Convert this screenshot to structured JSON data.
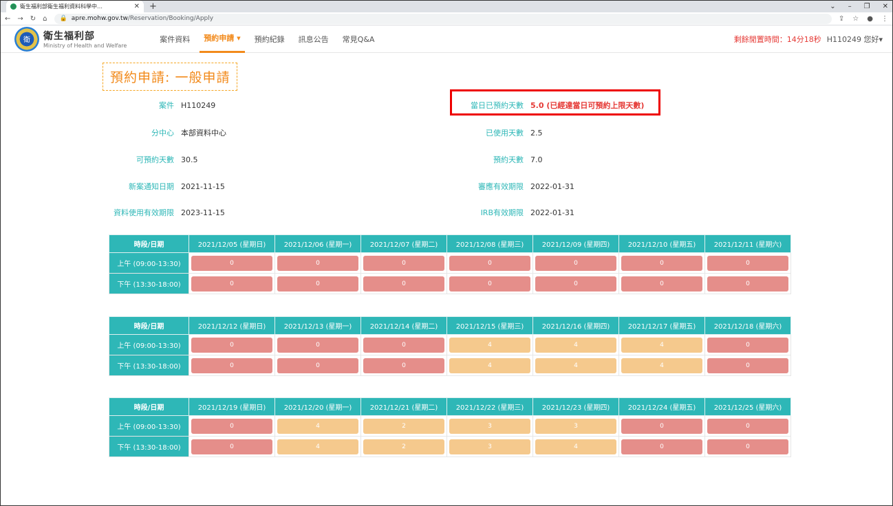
{
  "browser": {
    "tab_title": "衛生福利部衛生福利資料科學中…",
    "url_host": "apre.mohw.gov.tw",
    "url_path": "/Reservation/Booking/Apply"
  },
  "nav": {
    "brand_zh": "衛生福利部",
    "brand_en": "Ministry of Health and Welfare",
    "links": [
      "案件資料",
      "預約申請 ▾",
      "預約紀錄",
      "訊息公告",
      "常見Q&A"
    ],
    "timer": "剩餘閒置時間：14分18秒",
    "user": "H110249 您好▾"
  },
  "page": {
    "title": "預約申請: 一般申請"
  },
  "info": {
    "case_label": "案件",
    "case_value": "H110249",
    "center_label": "分中心",
    "center_value": "本部資料中心",
    "avail_label": "可預約天數",
    "avail_value": "30.5",
    "notify_label": "新案通知日期",
    "notify_value": "2021-11-15",
    "datause_label": "資料使用有效期限",
    "datause_value": "2023-11-15",
    "today_label": "當日已預約天數",
    "today_value": "5.0 (已經達當日可預約上限天數)",
    "used_label": "已使用天數",
    "used_value": "2.5",
    "reserved_label": "預約天數",
    "reserved_value": "7.0",
    "review_label": "審應有效期限",
    "review_value": "2022-01-31",
    "irb_label": "IRB有效期限",
    "irb_value": "2022-01-31"
  },
  "schedule": {
    "header_label": "時段/日期",
    "am_label": "上午 (09:00-13:30)",
    "pm_label": "下午 (13:30-18:00)",
    "weeks": [
      {
        "days": [
          "2021/12/05 (星期日)",
          "2021/12/06 (星期一)",
          "2021/12/07 (星期二)",
          "2021/12/08 (星期三)",
          "2021/12/09 (星期四)",
          "2021/12/10 (星期五)",
          "2021/12/11 (星期六)"
        ],
        "am": [
          "0",
          "0",
          "0",
          "0",
          "0",
          "0",
          "0"
        ],
        "pm": [
          "0",
          "0",
          "0",
          "0",
          "0",
          "0",
          "0"
        ]
      },
      {
        "days": [
          "2021/12/12 (星期日)",
          "2021/12/13 (星期一)",
          "2021/12/14 (星期二)",
          "2021/12/15 (星期三)",
          "2021/12/16 (星期四)",
          "2021/12/17 (星期五)",
          "2021/12/18 (星期六)"
        ],
        "am": [
          "0",
          "0",
          "0",
          "4",
          "4",
          "4",
          "0"
        ],
        "pm": [
          "0",
          "0",
          "0",
          "4",
          "4",
          "4",
          "0"
        ]
      },
      {
        "days": [
          "2021/12/19 (星期日)",
          "2021/12/20 (星期一)",
          "2021/12/21 (星期二)",
          "2021/12/22 (星期三)",
          "2021/12/23 (星期四)",
          "2021/12/24 (星期五)",
          "2021/12/25 (星期六)"
        ],
        "am": [
          "0",
          "4",
          "2",
          "3",
          "3",
          "0",
          "0"
        ],
        "pm": [
          "0",
          "4",
          "2",
          "3",
          "4",
          "0",
          "0"
        ]
      }
    ]
  }
}
